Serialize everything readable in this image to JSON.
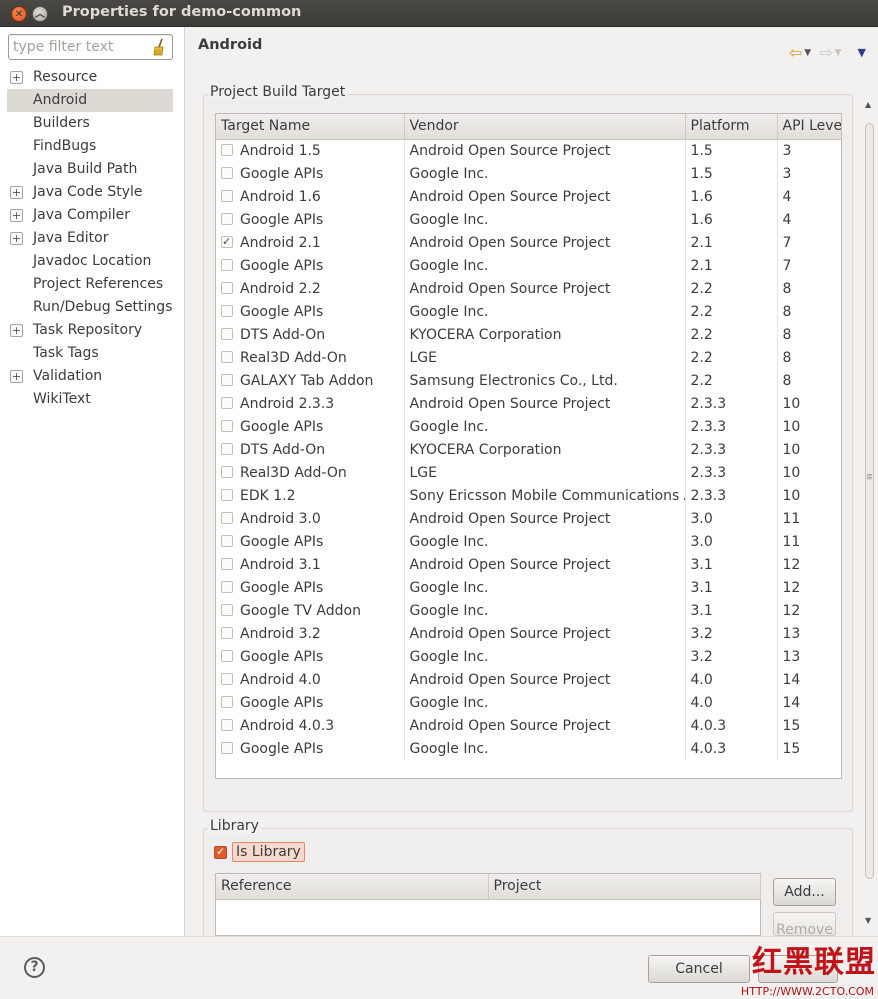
{
  "window": {
    "title": "Properties for demo-common"
  },
  "sidebar": {
    "filter_placeholder": "type filter text",
    "items": [
      {
        "label": "Resource",
        "expandable": true,
        "selected": false
      },
      {
        "label": "Android",
        "expandable": false,
        "selected": true
      },
      {
        "label": "Builders",
        "expandable": false,
        "selected": false
      },
      {
        "label": "FindBugs",
        "expandable": false,
        "selected": false
      },
      {
        "label": "Java Build Path",
        "expandable": false,
        "selected": false
      },
      {
        "label": "Java Code Style",
        "expandable": true,
        "selected": false
      },
      {
        "label": "Java Compiler",
        "expandable": true,
        "selected": false
      },
      {
        "label": "Java Editor",
        "expandable": true,
        "selected": false
      },
      {
        "label": "Javadoc Location",
        "expandable": false,
        "selected": false
      },
      {
        "label": "Project References",
        "expandable": false,
        "selected": false
      },
      {
        "label": "Run/Debug Settings",
        "expandable": false,
        "selected": false
      },
      {
        "label": "Task Repository",
        "expandable": true,
        "selected": false
      },
      {
        "label": "Task Tags",
        "expandable": false,
        "selected": false
      },
      {
        "label": "Validation",
        "expandable": true,
        "selected": false
      },
      {
        "label": "WikiText",
        "expandable": false,
        "selected": false
      }
    ]
  },
  "page": {
    "title": "Android"
  },
  "build_target": {
    "group_label": "Project Build Target",
    "columns": [
      "Target Name",
      "Vendor",
      "Platform",
      "API Leve"
    ],
    "rows": [
      {
        "checked": false,
        "name": "Android 1.5",
        "vendor": "Android Open Source Project",
        "platform": "1.5",
        "api": "3"
      },
      {
        "checked": false,
        "name": "Google APIs",
        "vendor": "Google Inc.",
        "platform": "1.5",
        "api": "3"
      },
      {
        "checked": false,
        "name": "Android 1.6",
        "vendor": "Android Open Source Project",
        "platform": "1.6",
        "api": "4"
      },
      {
        "checked": false,
        "name": "Google APIs",
        "vendor": "Google Inc.",
        "platform": "1.6",
        "api": "4"
      },
      {
        "checked": true,
        "name": "Android 2.1",
        "vendor": "Android Open Source Project",
        "platform": "2.1",
        "api": "7"
      },
      {
        "checked": false,
        "name": "Google APIs",
        "vendor": "Google Inc.",
        "platform": "2.1",
        "api": "7"
      },
      {
        "checked": false,
        "name": "Android 2.2",
        "vendor": "Android Open Source Project",
        "platform": "2.2",
        "api": "8"
      },
      {
        "checked": false,
        "name": "Google APIs",
        "vendor": "Google Inc.",
        "platform": "2.2",
        "api": "8"
      },
      {
        "checked": false,
        "name": "DTS Add-On",
        "vendor": "KYOCERA Corporation",
        "platform": "2.2",
        "api": "8"
      },
      {
        "checked": false,
        "name": "Real3D Add-On",
        "vendor": "LGE",
        "platform": "2.2",
        "api": "8"
      },
      {
        "checked": false,
        "name": "GALAXY Tab Addon",
        "vendor": "Samsung Electronics Co., Ltd.",
        "platform": "2.2",
        "api": "8"
      },
      {
        "checked": false,
        "name": "Android 2.3.3",
        "vendor": "Android Open Source Project",
        "platform": "2.3.3",
        "api": "10"
      },
      {
        "checked": false,
        "name": "Google APIs",
        "vendor": "Google Inc.",
        "platform": "2.3.3",
        "api": "10"
      },
      {
        "checked": false,
        "name": "DTS Add-On",
        "vendor": "KYOCERA Corporation",
        "platform": "2.3.3",
        "api": "10"
      },
      {
        "checked": false,
        "name": "Real3D Add-On",
        "vendor": "LGE",
        "platform": "2.3.3",
        "api": "10"
      },
      {
        "checked": false,
        "name": "EDK 1.2",
        "vendor": "Sony Ericsson Mobile Communications AB",
        "platform": "2.3.3",
        "api": "10"
      },
      {
        "checked": false,
        "name": "Android 3.0",
        "vendor": "Android Open Source Project",
        "platform": "3.0",
        "api": "11"
      },
      {
        "checked": false,
        "name": "Google APIs",
        "vendor": "Google Inc.",
        "platform": "3.0",
        "api": "11"
      },
      {
        "checked": false,
        "name": "Android 3.1",
        "vendor": "Android Open Source Project",
        "platform": "3.1",
        "api": "12"
      },
      {
        "checked": false,
        "name": "Google APIs",
        "vendor": "Google Inc.",
        "platform": "3.1",
        "api": "12"
      },
      {
        "checked": false,
        "name": "Google TV Addon",
        "vendor": "Google Inc.",
        "platform": "3.1",
        "api": "12"
      },
      {
        "checked": false,
        "name": "Android 3.2",
        "vendor": "Android Open Source Project",
        "platform": "3.2",
        "api": "13"
      },
      {
        "checked": false,
        "name": "Google APIs",
        "vendor": "Google Inc.",
        "platform": "3.2",
        "api": "13"
      },
      {
        "checked": false,
        "name": "Android 4.0",
        "vendor": "Android Open Source Project",
        "platform": "4.0",
        "api": "14"
      },
      {
        "checked": false,
        "name": "Google APIs",
        "vendor": "Google Inc.",
        "platform": "4.0",
        "api": "14"
      },
      {
        "checked": false,
        "name": "Android 4.0.3",
        "vendor": "Android Open Source Project",
        "platform": "4.0.3",
        "api": "15"
      },
      {
        "checked": false,
        "name": "Google APIs",
        "vendor": "Google Inc.",
        "platform": "4.0.3",
        "api": "15"
      }
    ]
  },
  "library": {
    "group_label": "Library",
    "is_library_label": "Is Library",
    "is_library_checked": true,
    "columns": [
      "Reference",
      "Project"
    ],
    "add_label": "Add...",
    "remove_label": "Remove"
  },
  "footer": {
    "help_label": "?",
    "cancel_label": "Cancel",
    "watermark_text": "红黑联盟",
    "watermark_url": "HTTP://WWW.2CTO.COM"
  },
  "colors": {
    "accent_orange": "#e05a2a",
    "selection": "#ddd9d3",
    "watermark_red": "#c0141a"
  }
}
